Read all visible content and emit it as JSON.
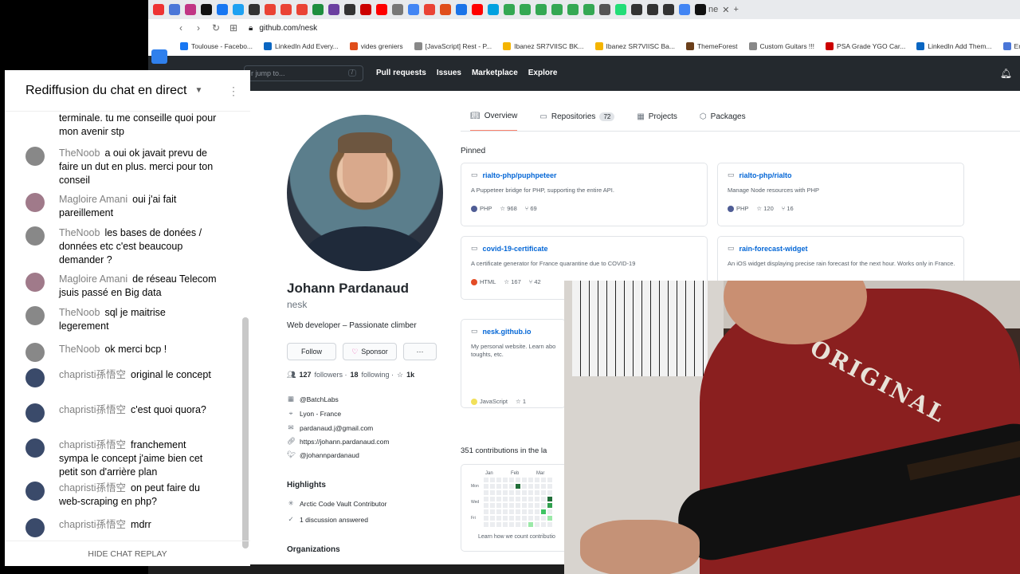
{
  "browser": {
    "url": "github.com/nesk",
    "tab_title": "ne",
    "bookmarks": [
      "Toulouse - Facebo...",
      "LinkedIn Add Every...",
      "vides greniers",
      "[JavaScript] Rest - P...",
      "Ibanez SR7VIISC BK...",
      "Ibanez SR7VIISC Ba...",
      "ThemeForest",
      "Custom Guitars !!!",
      "PSA Grade YGO Car...",
      "LinkedIn Add Them...",
      "Entreprises / Soc"
    ]
  },
  "github": {
    "search_placeholder": "r jump to...",
    "search_key": "/",
    "nav": [
      "Pull requests",
      "Issues",
      "Marketplace",
      "Explore"
    ],
    "tabs": [
      {
        "label": "Overview",
        "count": ""
      },
      {
        "label": "Repositories",
        "count": "72"
      },
      {
        "label": "Projects",
        "count": ""
      },
      {
        "label": "Packages",
        "count": ""
      }
    ],
    "profile": {
      "name": "Johann Pardanaud",
      "login": "nesk",
      "bio": "Web developer – Passionate climber",
      "follow": "Follow",
      "sponsor": "Sponsor",
      "more": "···",
      "followers": "127",
      "followers_label": "followers ·",
      "following": "18",
      "following_label": "following ·",
      "stars": "1k",
      "org": "@BatchLabs",
      "location": "Lyon - France",
      "email": "pardanaud.j@gmail.com",
      "website": "https://johann.pardanaud.com",
      "twitter": "@johannpardanaud",
      "highlights_title": "Highlights",
      "highlights": [
        "Arctic Code Vault Contributor",
        "1 discussion answered"
      ],
      "orgs_title": "Organizations"
    },
    "pinned_title": "Pinned",
    "pinned": [
      {
        "name": "rialto-php/puphpeteer",
        "desc": "A Puppeteer bridge for PHP, supporting the entire API.",
        "lang": "PHP",
        "lang_color": "#4F5D95",
        "stars": "968",
        "forks": "69"
      },
      {
        "name": "rialto-php/rialto",
        "desc": "Manage Node resources with PHP",
        "lang": "PHP",
        "lang_color": "#4F5D95",
        "stars": "120",
        "forks": "16"
      },
      {
        "name": "covid-19-certificate",
        "desc": "A certificate generator for France quarantine due to COVID-19",
        "lang": "HTML",
        "lang_color": "#e34c26",
        "stars": "167",
        "forks": "42"
      },
      {
        "name": "rain-forecast-widget",
        "desc": "An iOS widget displaying precise rain forecast for the next hour. Works only in France.",
        "lang": "",
        "lang_color": "",
        "stars": "",
        "forks": ""
      },
      {
        "name": "nesk.github.io",
        "desc": "My personal website. Learn abo toughts, etc.",
        "lang": "JavaScript",
        "lang_color": "#f1e05a",
        "stars": "1",
        "forks": ""
      }
    ],
    "contributions": "351 contributions in the la",
    "months": [
      "Jan",
      "Feb",
      "Mar"
    ],
    "days": [
      "Mon",
      "Wed",
      "Fri"
    ],
    "learn": "Learn how we count contributio"
  },
  "chat": {
    "title": "Rediffusion du chat en direct",
    "hide": "HIDE CHAT REPLAY",
    "messages": [
      {
        "author": "",
        "text": "terminale. tu me conseille quoi pour mon avenir stp"
      },
      {
        "author": "TheNoob",
        "text": "a oui ok javait prevu de faire un dut en plus. merci pour ton conseil"
      },
      {
        "author": "Magloire Amani",
        "text": "oui j'ai fait pareillement"
      },
      {
        "author": "TheNoob",
        "text": "les bases de donées / données etc c'est beaucoup demander ?"
      },
      {
        "author": "Magloire Amani",
        "text": "de réseau Telecom jsuis passé en Big data"
      },
      {
        "author": "TheNoob",
        "text": "sql je maitrise legerement"
      },
      {
        "author": "TheNoob",
        "text": "ok merci bcp !"
      },
      {
        "author": "chapristi孫悟空",
        "text": "original le concept"
      },
      {
        "author": "chapristi孫悟空",
        "text": "c'est quoi quora?"
      },
      {
        "author": "chapristi孫悟空",
        "text": "franchement sympa le concept j'aime bien cet petit son d'arrière plan"
      },
      {
        "author": "chapristi孫悟空",
        "text": "on peut faire du web-scraping en php?"
      },
      {
        "author": "chapristi孫悟空",
        "text": "mdrr"
      }
    ]
  },
  "webcam": {
    "shirt_text": "ORIGINAL"
  }
}
